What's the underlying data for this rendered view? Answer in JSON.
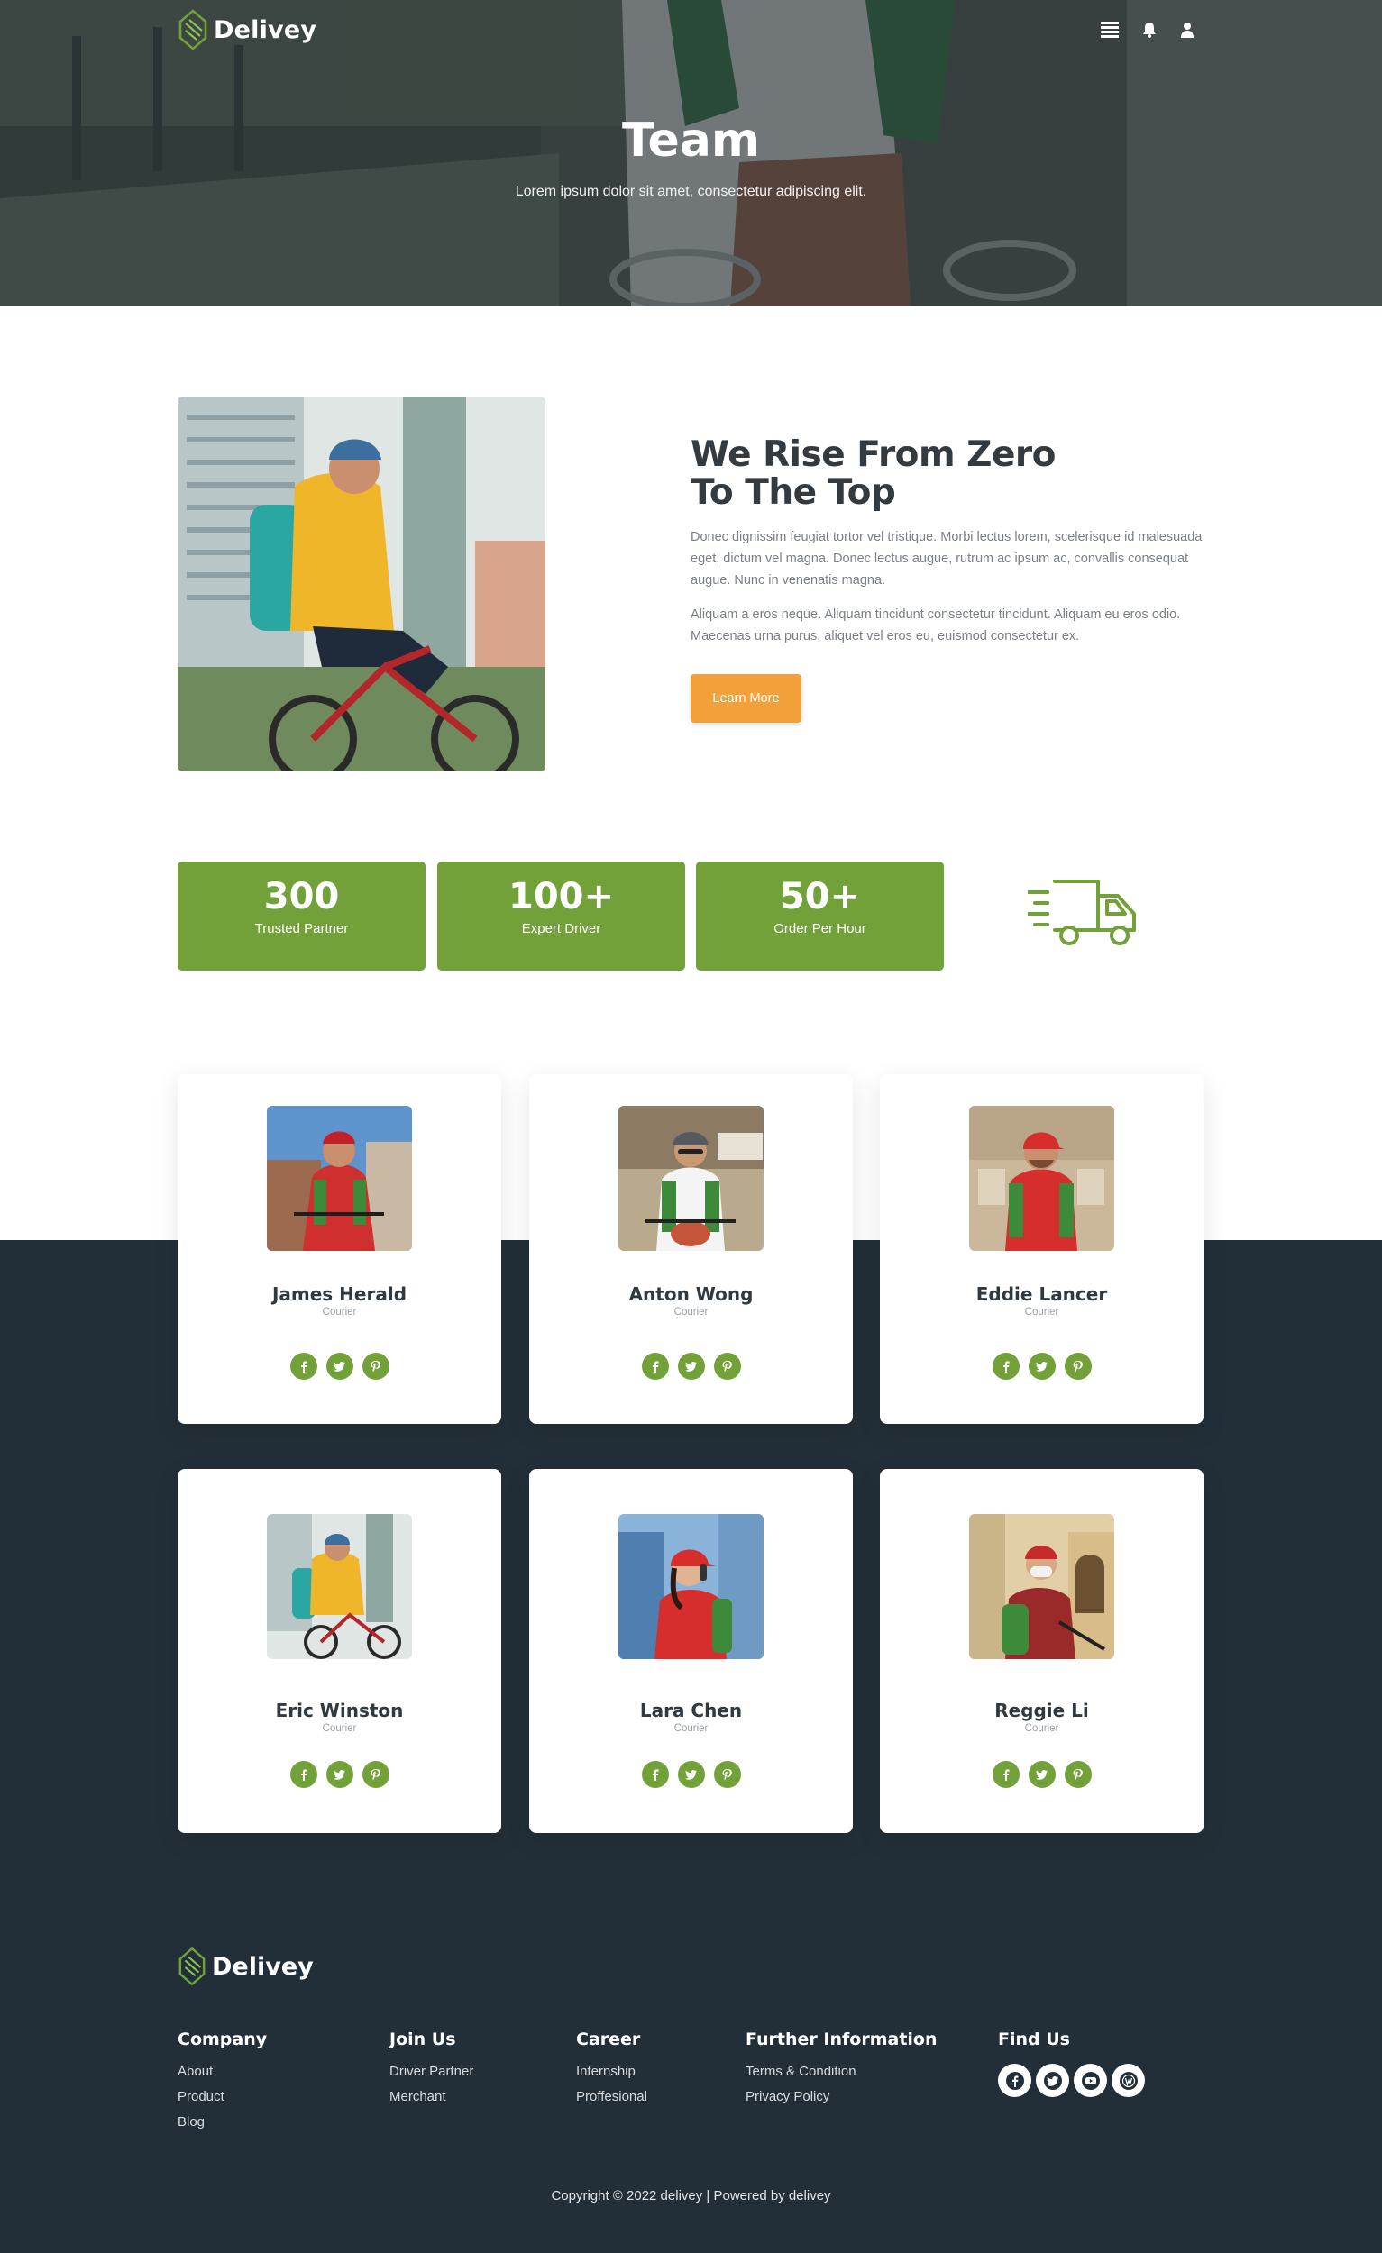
{
  "header": {
    "brand": "Delivey",
    "icons": [
      "menu-icon",
      "bell-icon",
      "user-icon"
    ]
  },
  "hero": {
    "title": "Team",
    "subtitle": "Lorem ipsum dolor sit amet, consectetur adipiscing elit."
  },
  "about": {
    "title_line1": "We Rise From Zero",
    "title_line2": "To The Top",
    "paragraph1": "Donec dignissim feugiat tortor vel tristique. Morbi lectus lorem, scelerisque id malesuada eget, dictum vel magna. Donec lectus augue, rutrum ac ipsum ac, convallis consequat augue. Nunc in venenatis magna.",
    "paragraph2": "Aliquam a eros neque. Aliquam tincidunt consectetur tincidunt. Aliquam eu eros odio. Maecenas urna purus, aliquet vel eros eu, euismod consectetur ex.",
    "button": "Learn More"
  },
  "stats": [
    {
      "value": "300",
      "label": "Trusted Partner"
    },
    {
      "value": "100+",
      "label": "Expert Driver"
    },
    {
      "value": "50+",
      "label": "Order Per Hour"
    }
  ],
  "team": [
    {
      "name": "James Herald",
      "role": "Courier"
    },
    {
      "name": "Anton Wong",
      "role": "Courier"
    },
    {
      "name": "Eddie Lancer",
      "role": "Courier"
    },
    {
      "name": "Eric Winston",
      "role": "Courier"
    },
    {
      "name": "Lara Chen",
      "role": "Courier"
    },
    {
      "name": "Reggie Li",
      "role": "Courier"
    }
  ],
  "footer": {
    "brand": "Delivey",
    "columns": [
      {
        "title": "Company",
        "links": [
          "About",
          "Product",
          "Blog"
        ]
      },
      {
        "title": "Join Us",
        "links": [
          "Driver Partner",
          "Merchant"
        ]
      },
      {
        "title": "Career",
        "links": [
          "Internship",
          "Proffesional"
        ]
      },
      {
        "title": "Further Information",
        "links": [
          "Terms & Condition",
          "Privacy Policy"
        ]
      }
    ],
    "find_us": "Find Us",
    "social_icons": [
      "facebook-icon",
      "twitter-icon",
      "youtube-icon",
      "wordpress-icon"
    ],
    "copyright": "Copyright © 2022 delivey | Powered by delivey"
  },
  "colors": {
    "accent_green": "#72a13a",
    "button_orange": "#f1a03a",
    "dark_navy": "#232f38"
  }
}
